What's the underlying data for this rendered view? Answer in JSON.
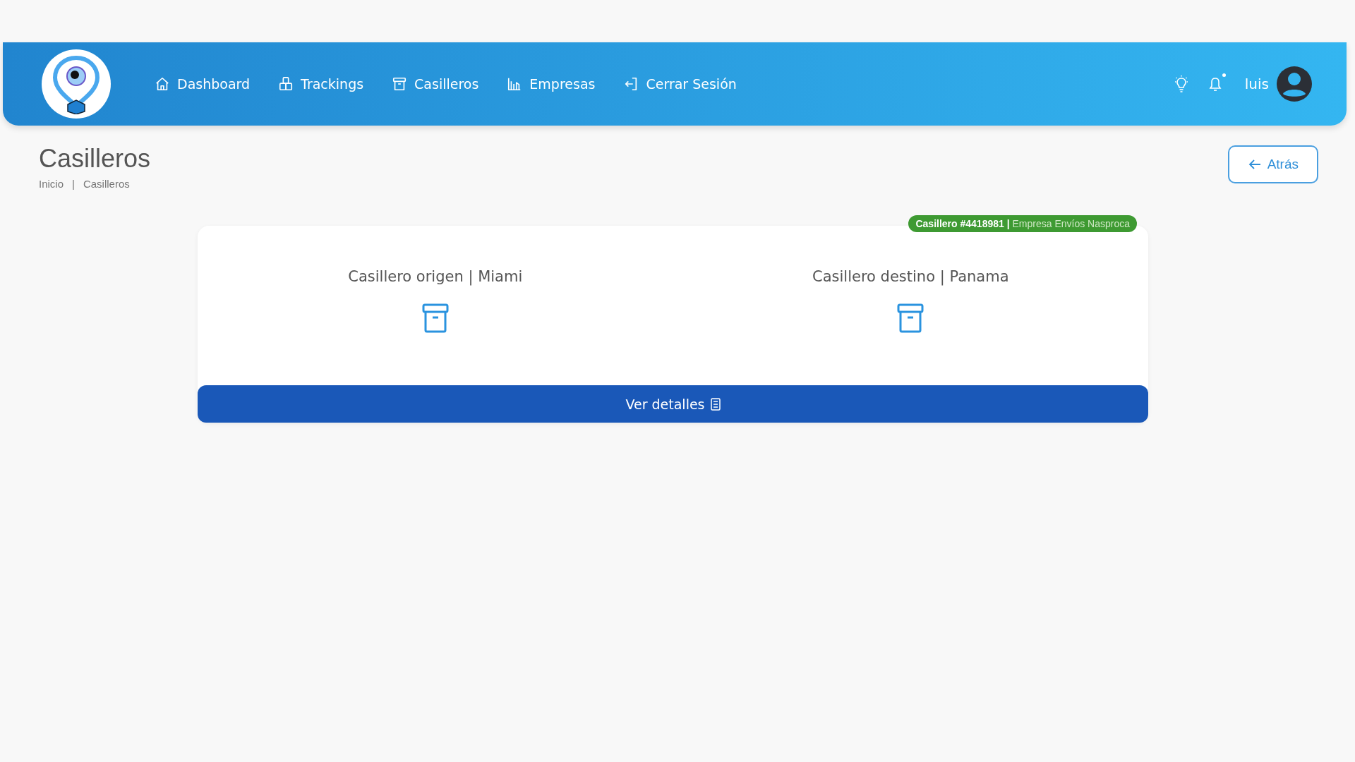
{
  "nav": {
    "items": [
      {
        "kind": "home",
        "label": "Dashboard"
      },
      {
        "kind": "boxes",
        "label": "Trackings"
      },
      {
        "kind": "archive",
        "label": "Casilleros"
      },
      {
        "kind": "chart",
        "label": "Empresas"
      },
      {
        "kind": "logout",
        "label": "Cerrar Sesión"
      }
    ],
    "user": "luis",
    "notification_dot": true
  },
  "page": {
    "title": "Casilleros",
    "breadcrumb": {
      "items": [
        "Inicio",
        "Casilleros"
      ],
      "separator": "|"
    },
    "back_button": "Atrás"
  },
  "card": {
    "badge": "**Casillero #4418981 |** Empresa Envíos Nasproca",
    "lockers": [
      {
        "label": "Casillero origen | Miami"
      },
      {
        "label": "Casillero destino | Panama"
      }
    ],
    "button": "Ver detalles"
  }
}
